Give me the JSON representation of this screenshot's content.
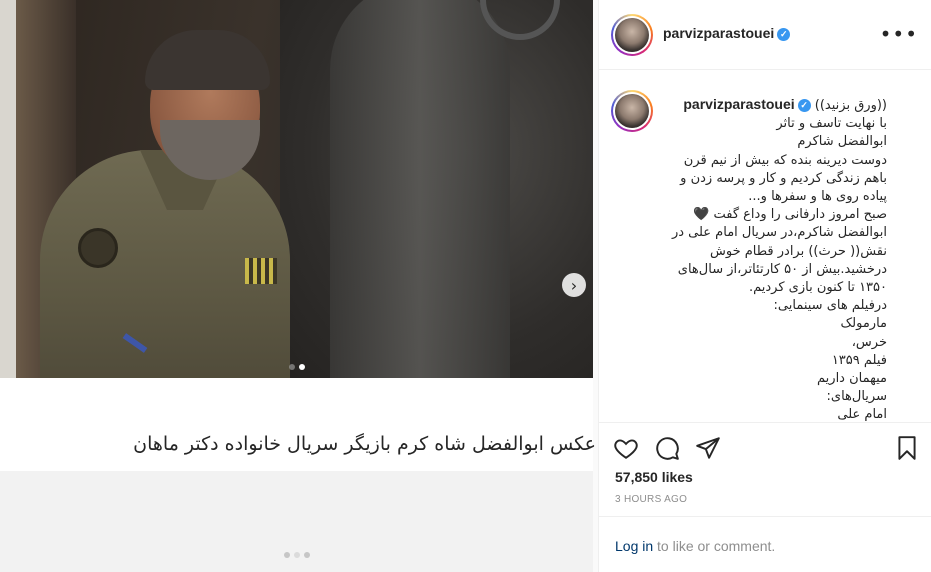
{
  "post": {
    "media_caption": "عکس ابوالفضل شاه کرم بازیگر سریال خانواده دکتر ماهان",
    "next_icon": "chevron-right-icon",
    "dots_count": 2,
    "dots_active": 2
  },
  "header": {
    "username": "parvizparastouei",
    "verified_icon": "verified-badge-icon",
    "more_icon": "more-options-icon",
    "more_label": "•••"
  },
  "caption": {
    "username": "parvizparastouei",
    "lines": [
      "((ورق بزنید))",
      "با نهایت تاسف و تاثر",
      "ابوالفضل شاکرم",
      "دوست دیرینه بنده که بیش از نیم قرن",
      "باهم زندگی کردیم و کار و پرسه زدن و",
      "پیاده روی ها و سفرها و...",
      "صبح امروز دارفانی را وداع گفت 🖤",
      "ابوالفضل شاکرم،در سریال امام علی در",
      "نقش(( حرث)) برادر قطام خوش",
      "درخشید.بیش از ۵۰ کارتئاتر،از سال‌های",
      "۱۳۵۰ تا کنون بازی کردیم.",
      "درفیلم های سینمایی:",
      "مارمولک",
      "خرس،",
      "فیلم ۱۳۵۹",
      "میهمان داریم",
      "سریال‌های:",
      "امام علی"
    ]
  },
  "actions": {
    "like_icon": "heart-icon",
    "comment_icon": "comment-icon",
    "share_icon": "paper-plane-icon",
    "save_icon": "bookmark-icon"
  },
  "likes": "57,850 likes",
  "time": "3 HOURS AGO",
  "login": {
    "link": "Log in",
    "rest": " to like or comment."
  },
  "colors": {
    "verified": "#3897f0",
    "link": "#00376b",
    "muted": "#8e8e8e",
    "text": "#262626"
  }
}
